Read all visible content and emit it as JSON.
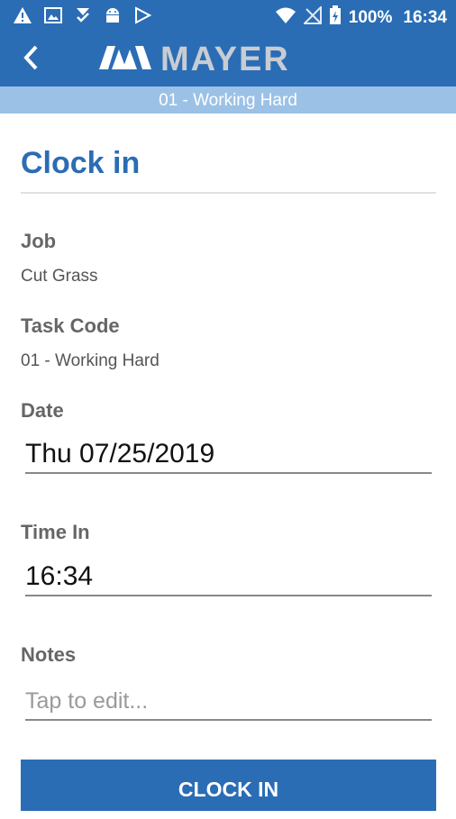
{
  "status_bar": {
    "battery_percent": "100%",
    "time": "16:34",
    "icons": [
      "warning-icon",
      "image-icon",
      "download-check-icon",
      "android-icon",
      "play-store-icon",
      "wifi-icon",
      "no-signal-icon",
      "battery-charging-icon"
    ]
  },
  "app_bar": {
    "logo_text": "MAYER",
    "subtitle": "01 - Working Hard"
  },
  "page": {
    "title": "Clock in"
  },
  "form": {
    "job_label": "Job",
    "job_value": "Cut Grass",
    "task_label": "Task Code",
    "task_value": "01 - Working Hard",
    "date_label": "Date",
    "date_value": "Thu 07/25/2019",
    "time_label": "Time In",
    "time_value": "16:34",
    "notes_label": "Notes",
    "notes_placeholder": "Tap to edit..."
  },
  "actions": {
    "clock_in_label": "CLOCK IN"
  },
  "colors": {
    "primary": "#2a6db5",
    "subbar": "#9bc1e6",
    "logo_gray": "#c8ccd3"
  }
}
